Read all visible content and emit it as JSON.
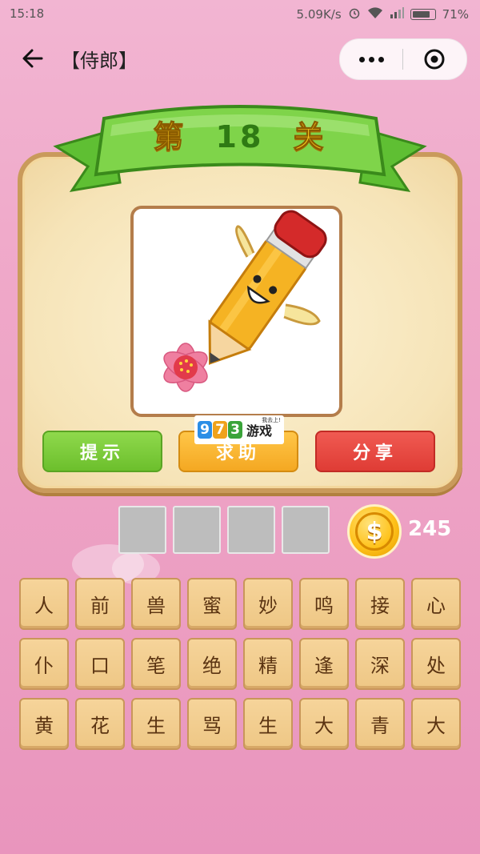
{
  "status_bar": {
    "time": "15:18",
    "network_speed": "5.09K/s",
    "battery": "71%"
  },
  "nav": {
    "title": "【侍郎】"
  },
  "level": {
    "prefix": "第",
    "number": "18",
    "suffix": "关"
  },
  "buttons": {
    "hint": "提示",
    "help": "求助",
    "share": "分享"
  },
  "watermark": {
    "digits": [
      "9",
      "7",
      "3"
    ],
    "text": "游戏",
    "tag": "我去上!"
  },
  "answer_slots": [
    "",
    "",
    "",
    ""
  ],
  "coins": {
    "count": "245",
    "symbol": "$"
  },
  "letters": [
    "人",
    "前",
    "兽",
    "蜜",
    "妙",
    "鸣",
    "接",
    "心",
    "仆",
    "口",
    "笔",
    "绝",
    "精",
    "逢",
    "深",
    "处",
    "黄",
    "花",
    "生",
    "骂",
    "生",
    "大",
    "青",
    "大"
  ],
  "colors": {
    "hint": "#7ccc38",
    "help": "#f7b22e",
    "share": "#e5463f"
  }
}
